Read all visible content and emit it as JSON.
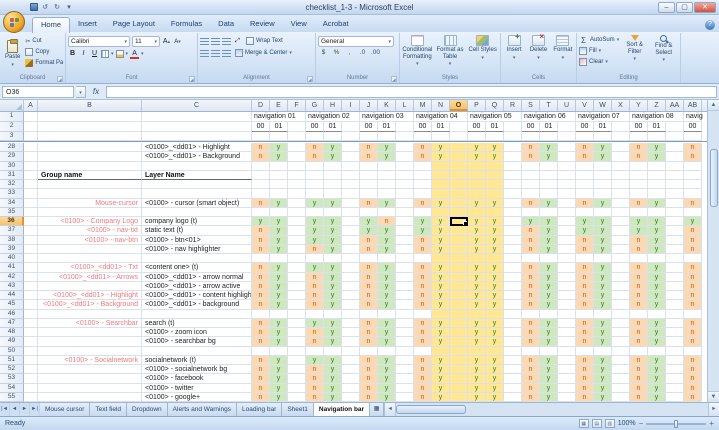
{
  "window": {
    "title": "checklist_1-3 - Microsoft Excel"
  },
  "colors": {
    "y_bg": "#cfe8bd",
    "y_text": "#2f7a1e",
    "n_bg": "#fcd9b0",
    "n_text": "#cf5b11",
    "band_bg": "#ffe793",
    "group_text": "#f07a7a",
    "selection_accent": "#e98f2e"
  },
  "ribbon": {
    "tabs": [
      "Home",
      "Insert",
      "Page Layout",
      "Formulas",
      "Data",
      "Review",
      "View",
      "Acrobat"
    ],
    "active_tab": "Home",
    "clipboard": {
      "label": "Clipboard",
      "paste": "Paste",
      "cut": "Cut",
      "copy": "Copy",
      "format_painter": "Format Painter"
    },
    "font": {
      "label": "Font",
      "font_name": "Calibri",
      "font_size": "11"
    },
    "alignment": {
      "label": "Alignment",
      "wrap_text": "Wrap Text",
      "merge_center": "Merge & Center"
    },
    "number": {
      "label": "Number",
      "format": "General"
    },
    "styles": {
      "label": "Styles",
      "conditional": "Conditional Formatting",
      "format_table": "Format as Table",
      "cell_styles": "Cell Styles"
    },
    "cells": {
      "label": "Cells",
      "insert": "Insert",
      "delete": "Delete",
      "format": "Format"
    },
    "editing": {
      "label": "Editing",
      "autosum": "AutoSum",
      "fill": "Fill",
      "clear": "Clear",
      "sort_filter": "Sort & Filter",
      "find_select": "Find & Select"
    }
  },
  "formula_bar": {
    "name_box": "O36",
    "fx": "fx",
    "value": ""
  },
  "sheet": {
    "columns": [
      "A",
      "B",
      "C",
      "D",
      "E",
      "F",
      "G",
      "H",
      "I",
      "J",
      "K",
      "L",
      "M",
      "N",
      "O",
      "P",
      "Q",
      "R",
      "S",
      "T",
      "U",
      "V",
      "W",
      "X",
      "Y",
      "Z",
      "AA",
      "AB"
    ],
    "value_columns": [
      "D",
      "E",
      "G",
      "H",
      "J",
      "K",
      "M",
      "N",
      "P",
      "Q",
      "S",
      "T",
      "V",
      "W",
      "Y",
      "Z",
      "AB"
    ],
    "band_columns": [
      "N",
      "O",
      "P",
      "Q"
    ],
    "selected_column": "O",
    "selected_row": 36,
    "top_row_numbers": [
      "1",
      "2",
      "3"
    ],
    "nav_blocks": [
      {
        "start": "D",
        "label": "navigation 01"
      },
      {
        "start": "G",
        "label": "navigation 02"
      },
      {
        "start": "J",
        "label": "navigation 03"
      },
      {
        "start": "M",
        "label": "navigation 04"
      },
      {
        "start": "P",
        "label": "navigation 05"
      },
      {
        "start": "S",
        "label": "navigation 06"
      },
      {
        "start": "V",
        "label": "navigation 07"
      },
      {
        "start": "Y",
        "label": "navigation 08"
      },
      {
        "start": "AB",
        "label": "navig"
      }
    ],
    "sub_headers": {
      "D": "00",
      "E": "01",
      "G": "00",
      "H": "01",
      "J": "00",
      "K": "01",
      "M": "00",
      "N": "01",
      "P": "00",
      "Q": "01",
      "S": "00",
      "T": "01",
      "V": "00",
      "W": "01",
      "Y": "00",
      "Z": "01",
      "AB": "00"
    },
    "rows": [
      {
        "num": 28,
        "group": "",
        "layer": "<0100>_<dd01> - Highlight",
        "vals": [
          "n",
          "y",
          "n",
          "y",
          "n",
          "y",
          "n",
          "y",
          "y",
          "y",
          "n",
          "y",
          "n",
          "y",
          "n",
          "y",
          "n"
        ]
      },
      {
        "num": 29,
        "group": "",
        "layer": "<0100>_<dd01> - Background",
        "vals": [
          "n",
          "y",
          "n",
          "y",
          "n",
          "y",
          "n",
          "y",
          "y",
          "y",
          "n",
          "y",
          "n",
          "y",
          "n",
          "y",
          "n"
        ]
      },
      {
        "num": 30,
        "group": "",
        "layer": "",
        "vals": [
          "",
          "",
          "",
          "",
          "",
          "",
          "",
          "",
          "",
          "",
          "",
          "",
          "",
          "",
          "",
          "",
          ""
        ]
      },
      {
        "num": 31,
        "group": "Group name",
        "layer": "Layer Name",
        "header": true,
        "vals": [
          "",
          "",
          "",
          "",
          "",
          "",
          "",
          "",
          "",
          "",
          "",
          "",
          "",
          "",
          "",
          "",
          ""
        ]
      },
      {
        "num": 32,
        "group": "",
        "layer": "",
        "vals": [
          "",
          "",
          "",
          "",
          "",
          "",
          "",
          "",
          "",
          "",
          "",
          "",
          "",
          "",
          "",
          "",
          ""
        ]
      },
      {
        "num": 33,
        "group": "",
        "layer": "",
        "vals": [
          "",
          "",
          "",
          "",
          "",
          "",
          "",
          "",
          "",
          "",
          "",
          "",
          "",
          "",
          "",
          "",
          ""
        ]
      },
      {
        "num": 34,
        "group": "Mouse-cursor",
        "layer": "<0100> - cursor (smart object)",
        "vals": [
          "n",
          "y",
          "y",
          "y",
          "n",
          "y",
          "n",
          "y",
          "y",
          "y",
          "n",
          "y",
          "n",
          "y",
          "n",
          "y",
          "n"
        ]
      },
      {
        "num": 35,
        "group": "",
        "layer": "",
        "vals": [
          "",
          "",
          "",
          "",
          "",
          "",
          "",
          "",
          "",
          "",
          "",
          "",
          "",
          "",
          "",
          "",
          ""
        ]
      },
      {
        "num": 36,
        "group": "<0100> - Company Logo",
        "layer": "company logo (t)",
        "vals": [
          "y",
          "y",
          "y",
          "y",
          "y",
          "n",
          "y",
          "y",
          "y",
          "y",
          "y",
          "y",
          "y",
          "y",
          "y",
          "y",
          "y"
        ]
      },
      {
        "num": 37,
        "group": "<0100> - nav-txt",
        "layer": "static text (t)",
        "vals": [
          "n",
          "y",
          "y",
          "y",
          "y",
          "y",
          "y",
          "y",
          "y",
          "y",
          "n",
          "y",
          "y",
          "y",
          "y",
          "y",
          "n"
        ]
      },
      {
        "num": 38,
        "group": "<0100> - nav-btn",
        "layer": "<0100> - btn<01>",
        "vals": [
          "n",
          "y",
          "y",
          "y",
          "n",
          "y",
          "n",
          "y",
          "y",
          "y",
          "n",
          "y",
          "n",
          "y",
          "n",
          "y",
          "n"
        ]
      },
      {
        "num": 39,
        "group": "",
        "layer": "<0100> - nav highlighter",
        "vals": [
          "n",
          "y",
          "n",
          "y",
          "n",
          "y",
          "n",
          "y",
          "y",
          "y",
          "n",
          "y",
          "n",
          "y",
          "n",
          "y",
          "n"
        ]
      },
      {
        "num": 40,
        "group": "",
        "layer": "",
        "vals": [
          "",
          "",
          "",
          "",
          "",
          "",
          "",
          "",
          "",
          "",
          "",
          "",
          "",
          "",
          "",
          "",
          ""
        ]
      },
      {
        "num": 41,
        "group": "<0100>_<dd01> - Txt",
        "layer": "<content one> (t)",
        "vals": [
          "n",
          "y",
          "y",
          "y",
          "n",
          "y",
          "n",
          "y",
          "y",
          "y",
          "n",
          "y",
          "n",
          "y",
          "n",
          "y",
          "n"
        ]
      },
      {
        "num": 42,
        "group": "<0100>_<dd01> - Arrows",
        "layer": "<0100>_<dd01> - arrow normal",
        "vals": [
          "n",
          "y",
          "n",
          "y",
          "n",
          "y",
          "n",
          "y",
          "y",
          "y",
          "n",
          "y",
          "n",
          "y",
          "n",
          "y",
          "n"
        ]
      },
      {
        "num": 43,
        "group": "",
        "layer": "<0100>_<dd01> - arrow active",
        "vals": [
          "n",
          "y",
          "n",
          "y",
          "n",
          "y",
          "n",
          "y",
          "y",
          "y",
          "n",
          "y",
          "n",
          "y",
          "n",
          "y",
          "n"
        ]
      },
      {
        "num": 44,
        "group": "<0100>_<dd01> - Highlight",
        "layer": "<0100>_<dd01> - content highlighted",
        "vals": [
          "n",
          "y",
          "n",
          "y",
          "n",
          "y",
          "n",
          "y",
          "y",
          "y",
          "n",
          "y",
          "n",
          "y",
          "n",
          "y",
          "n"
        ]
      },
      {
        "num": 45,
        "group": "<0100>_<dd01> - Background",
        "layer": "<0100>_<dd01> - background",
        "vals": [
          "n",
          "y",
          "n",
          "y",
          "n",
          "y",
          "n",
          "y",
          "y",
          "y",
          "n",
          "y",
          "n",
          "y",
          "n",
          "y",
          "n"
        ]
      },
      {
        "num": 46,
        "group": "",
        "layer": "",
        "vals": [
          "",
          "",
          "",
          "",
          "",
          "",
          "",
          "",
          "",
          "",
          "",
          "",
          "",
          "",
          "",
          "",
          ""
        ]
      },
      {
        "num": 47,
        "group": "<0100> - Searchbar",
        "layer": "search (t)",
        "vals": [
          "n",
          "y",
          "y",
          "y",
          "n",
          "y",
          "n",
          "y",
          "y",
          "y",
          "n",
          "y",
          "n",
          "y",
          "n",
          "y",
          "n"
        ]
      },
      {
        "num": 48,
        "group": "",
        "layer": "<0100> - zoom icon",
        "vals": [
          "n",
          "y",
          "n",
          "y",
          "n",
          "y",
          "n",
          "y",
          "y",
          "y",
          "n",
          "y",
          "n",
          "y",
          "n",
          "y",
          "n"
        ]
      },
      {
        "num": 49,
        "group": "",
        "layer": "<0100> - searchbar bg",
        "vals": [
          "n",
          "y",
          "n",
          "y",
          "n",
          "y",
          "n",
          "y",
          "y",
          "y",
          "n",
          "y",
          "n",
          "y",
          "n",
          "y",
          "n"
        ]
      },
      {
        "num": 50,
        "group": "",
        "layer": "",
        "vals": [
          "",
          "",
          "",
          "",
          "",
          "",
          "",
          "",
          "",
          "",
          "",
          "",
          "",
          "",
          "",
          "",
          ""
        ]
      },
      {
        "num": 51,
        "group": "<0100> - Socialnetwork",
        "layer": "socialnetwork (t)",
        "vals": [
          "n",
          "y",
          "y",
          "y",
          "n",
          "y",
          "n",
          "y",
          "y",
          "y",
          "n",
          "y",
          "n",
          "y",
          "n",
          "y",
          "n"
        ]
      },
      {
        "num": 52,
        "group": "",
        "layer": "<0100> - socialnetwork bg",
        "vals": [
          "n",
          "y",
          "n",
          "y",
          "n",
          "y",
          "n",
          "y",
          "y",
          "y",
          "n",
          "y",
          "n",
          "y",
          "n",
          "y",
          "n"
        ]
      },
      {
        "num": 53,
        "group": "",
        "layer": "<0100> - facebook",
        "vals": [
          "n",
          "y",
          "n",
          "y",
          "n",
          "y",
          "n",
          "y",
          "y",
          "y",
          "n",
          "y",
          "n",
          "y",
          "n",
          "y",
          "n"
        ]
      },
      {
        "num": 54,
        "group": "",
        "layer": "<0100> - twitter",
        "vals": [
          "n",
          "y",
          "n",
          "y",
          "n",
          "y",
          "n",
          "y",
          "y",
          "y",
          "n",
          "y",
          "n",
          "y",
          "n",
          "y",
          "n"
        ]
      },
      {
        "num": 55,
        "group": "",
        "layer": "<0100> - google+",
        "vals": [
          "n",
          "y",
          "n",
          "y",
          "n",
          "y",
          "n",
          "y",
          "y",
          "y",
          "n",
          "y",
          "n",
          "y",
          "n",
          "y",
          "n"
        ]
      }
    ]
  },
  "sheet_tabs": {
    "tabs": [
      "Mouse cursor",
      "Text field",
      "Dropdown",
      "Alerts and Warnings",
      "Loading bar",
      "Sheet1",
      "Navigation bar"
    ],
    "active": "Navigation bar"
  },
  "status_bar": {
    "mode": "Ready",
    "zoom": "100%"
  }
}
